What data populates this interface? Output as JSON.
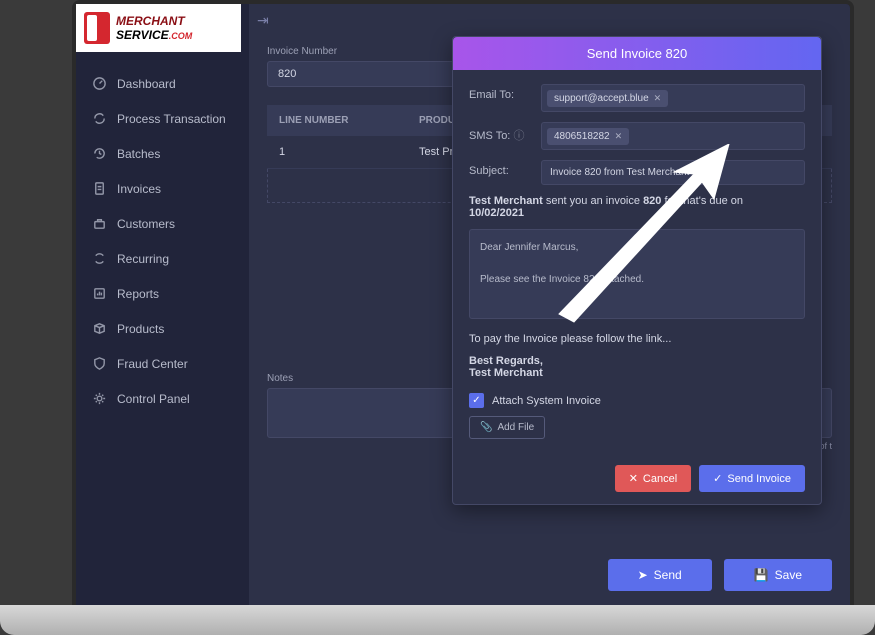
{
  "logo": {
    "line1": "MERCHANT",
    "line2": "SERVICE",
    "suffix": ".COM"
  },
  "sidebar": {
    "items": [
      {
        "label": "Dashboard",
        "icon": "gauge-icon"
      },
      {
        "label": "Process Transaction",
        "icon": "refresh-icon"
      },
      {
        "label": "Batches",
        "icon": "history-icon"
      },
      {
        "label": "Invoices",
        "icon": "document-icon"
      },
      {
        "label": "Customers",
        "icon": "briefcase-icon"
      },
      {
        "label": "Recurring",
        "icon": "cycle-icon"
      },
      {
        "label": "Reports",
        "icon": "report-icon"
      },
      {
        "label": "Products",
        "icon": "box-icon"
      },
      {
        "label": "Fraud Center",
        "icon": "shield-icon"
      },
      {
        "label": "Control Panel",
        "icon": "gear-icon"
      }
    ]
  },
  "invoice_form": {
    "number_label": "Invoice Number",
    "number_value": "820",
    "table": {
      "headers": {
        "line_number": "LINE NUMBER",
        "product": "PRODUCT"
      },
      "rows": [
        {
          "line_number": "1",
          "product": "Test Product"
        }
      ]
    },
    "notes_label": "Notes",
    "due_hint": "ue on last day of t"
  },
  "modal": {
    "title": "Send Invoice 820",
    "email_label": "Email To:",
    "email_chip": "support@accept.blue",
    "sms_label": "SMS To:",
    "sms_chip": "4806518282",
    "subject_label": "Subject:",
    "subject_value": "Invoice 820 from Test Merchant",
    "summary_merchant": "Test Merchant",
    "summary_mid": " sent you an invoice ",
    "summary_invno": "820",
    "summary_tail": " for that's due on ",
    "summary_date": "10/02/2021",
    "body_greeting": "Dear Jennifer Marcus,",
    "body_line": "Please see the Invoice 820 attached.",
    "pay_link_text": "To pay the Invoice please follow the link...",
    "regards": "Best Regards,",
    "merchant_sig": "Test Merchant",
    "attach_label": "Attach System Invoice",
    "addfile_label": "Add File",
    "cancel_label": "Cancel",
    "send_label": "Send Invoice"
  },
  "actions": {
    "send": "Send",
    "save": "Save"
  }
}
